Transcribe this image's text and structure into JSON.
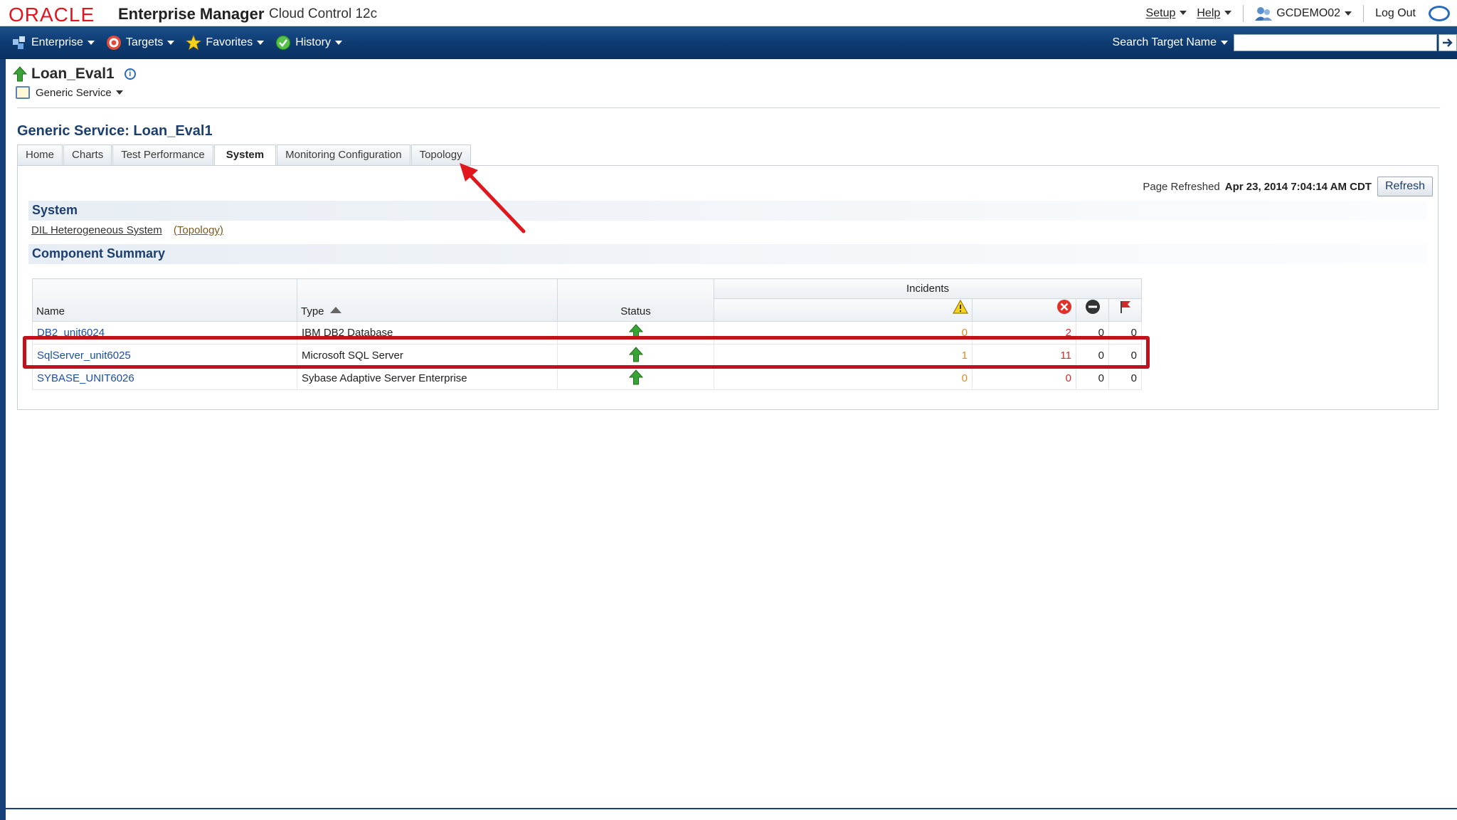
{
  "brand": {
    "logo": "ORACLE",
    "product": "Enterprise Manager",
    "product_sub": "Cloud Control 12c",
    "setup": "Setup",
    "help": "Help",
    "user": "GCDEMO02",
    "logout": "Log Out"
  },
  "nav": {
    "items": [
      {
        "label": "Enterprise",
        "icon": "enterprise-icon"
      },
      {
        "label": "Targets",
        "icon": "targets-icon"
      },
      {
        "label": "Favorites",
        "icon": "star-icon"
      },
      {
        "label": "History",
        "icon": "history-icon"
      }
    ],
    "search_label": "Search Target Name",
    "search_placeholder": ""
  },
  "target": {
    "name": "Loan_Eval1",
    "type_menu": "Generic Service"
  },
  "page": {
    "heading": "Generic Service: Loan_Eval1",
    "tabs": [
      "Home",
      "Charts",
      "Test Performance",
      "System",
      "Monitoring Configuration",
      "Topology"
    ],
    "active_tab": "System",
    "refreshed_label": "Page Refreshed",
    "refreshed_value": "Apr 23, 2014 7:04:14 AM CDT",
    "refresh_button": "Refresh"
  },
  "system": {
    "header": "System",
    "link": "DIL Heterogeneous System",
    "topology_link": "(Topology)"
  },
  "components": {
    "header": "Component Summary",
    "columns": {
      "name": "Name",
      "type": "Type",
      "status": "Status",
      "incidents": "Incidents"
    },
    "rows": [
      {
        "name": "DB2_unit6024",
        "type": "IBM DB2 Database",
        "status": "up",
        "warning": "0",
        "critical": "2",
        "escalated": "0",
        "flagged": "0"
      },
      {
        "name": "SqlServer_unit6025",
        "type": "Microsoft SQL Server",
        "status": "up",
        "warning": "1",
        "critical": "11",
        "escalated": "0",
        "flagged": "0"
      },
      {
        "name": "SYBASE_UNIT6026",
        "type": "Sybase Adaptive Server Enterprise",
        "status": "up",
        "warning": "0",
        "critical": "0",
        "escalated": "0",
        "flagged": "0"
      }
    ]
  },
  "colors": {
    "brand_red": "#e3141e",
    "nav_blue": "#0d3a70",
    "highlight_red": "#c0121c",
    "status_green": "#3aa335"
  }
}
